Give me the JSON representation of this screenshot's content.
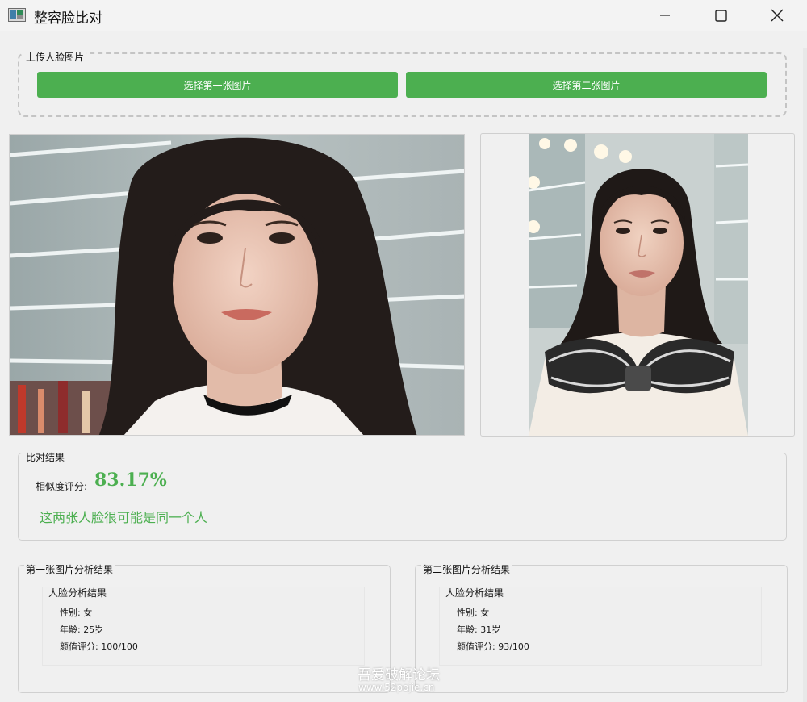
{
  "window": {
    "title": "整容脸比对",
    "icon": "app-window-icon",
    "controls": [
      "minimize-icon",
      "maximize-icon",
      "close-icon"
    ]
  },
  "upload": {
    "group_title": "上传人脸图片",
    "button_first": "选择第一张图片",
    "button_second": "选择第二张图片",
    "button_color": "#4caf50"
  },
  "images": {
    "first": "portrait photo of a woman with long wavy dark hair and bangs, white top, shelves behind",
    "second": "portrait photo of a woman with long dark hair and bangs, cream sweater with black and white striped bow collar, mirror lights behind"
  },
  "result": {
    "group_title": "比对结果",
    "similarity_label": "相似度评分:",
    "similarity_value": "83.17%",
    "verdict": "这两张人脸很可能是同一个人",
    "accent_color": "#4caf50"
  },
  "analysis": {
    "first": {
      "group_title": "第一张图片分析结果",
      "inner_title": "人脸分析结果",
      "gender": "性别: 女",
      "age": "年龄: 25岁",
      "beauty": "颜值评分: 100/100"
    },
    "second": {
      "group_title": "第二张图片分析结果",
      "inner_title": "人脸分析结果",
      "gender": "性别: 女",
      "age": "年龄: 31岁",
      "beauty": "颜值评分: 93/100"
    }
  },
  "watermark": {
    "main": "吾爱破解论坛",
    "sub": "www.52pojie.cn"
  }
}
